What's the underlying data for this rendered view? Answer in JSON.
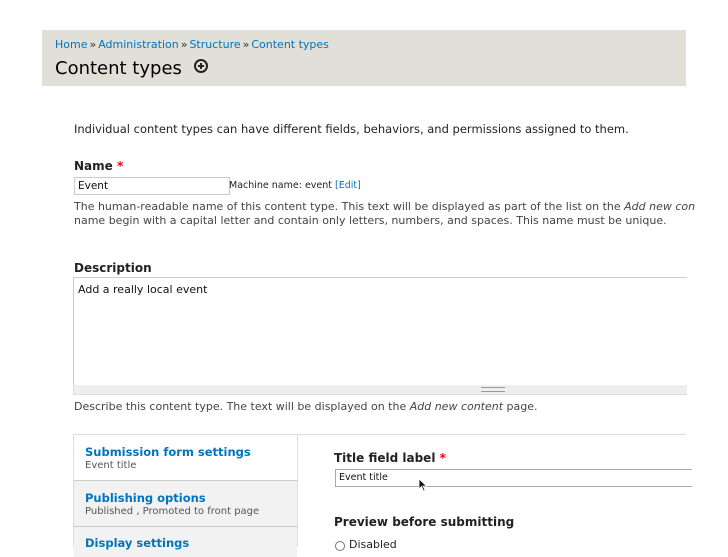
{
  "breadcrumb": {
    "items": [
      "Home",
      "Administration",
      "Structure",
      "Content types"
    ],
    "separator": "»"
  },
  "page_title": "Content types",
  "intro_text": "Individual content types can have different fields, behaviors, and permissions assigned to them.",
  "name_field": {
    "label": "Name",
    "required_mark": "*",
    "value": "Event",
    "machine_name_label": "Machine name: event",
    "edit_link": "[Edit]",
    "help_line1_prefix": "The human-readable name of this content type. This text will be displayed as part of the list on the ",
    "help_line1_emph": "Add new con",
    "help_line2": "name begin with a capital letter and contain only letters, numbers, and spaces. This name must be unique."
  },
  "description_field": {
    "label": "Description",
    "value": "Add a really local event",
    "help_prefix": "Describe this content type. The text will be displayed on the ",
    "help_emph": "Add new content",
    "help_suffix": " page."
  },
  "vertical_tabs": [
    {
      "title": "Submission form settings",
      "summary": "Event title"
    },
    {
      "title": "Publishing options",
      "summary": "Published , Promoted to front page"
    },
    {
      "title": "Display settings",
      "summary": ""
    }
  ],
  "title_field": {
    "label": "Title field label",
    "required_mark": "*",
    "value": "Event title"
  },
  "preview": {
    "label": "Preview before submitting",
    "option_label": "Disabled"
  },
  "colors": {
    "link": "#0074bd",
    "header_bg": "#e0e0d8",
    "required": "#ee0000"
  }
}
